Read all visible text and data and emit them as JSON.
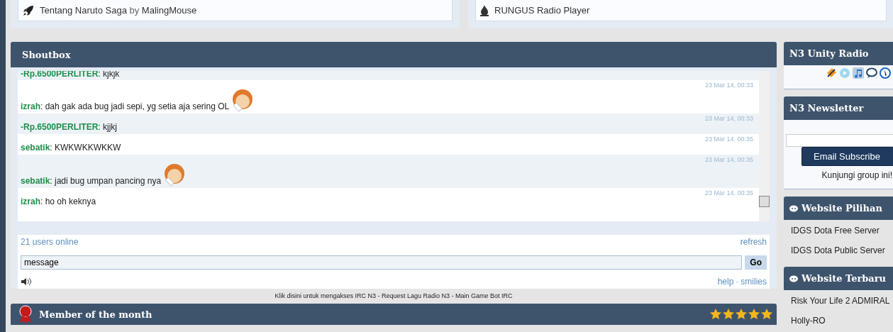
{
  "top_links": [
    {
      "kind": "rocket",
      "title": "Tentang Naruto Saga",
      "by": "by",
      "author": "MalingMouse"
    },
    {
      "kind": "flame",
      "title": "RUNGUS Radio Player"
    }
  ],
  "shoutbox": {
    "title": "Shoutbox",
    "messages": [
      {
        "user": "-Rp.6500PERLITER",
        "text": "kjkjk",
        "emoticon": false
      },
      {
        "time": "23 Mar 14, 00:33",
        "user": "izrah",
        "text": "dah gak ada bug jadi sepi, yg setia aja sering OL",
        "emoticon": true
      },
      {
        "time": "23 Mar 14, 00:33",
        "user": "-Rp.6500PERLITER",
        "text": "kjjkj",
        "emoticon": false
      },
      {
        "time": "23 Mar 14, 00:35",
        "user": "sebatik",
        "text": "KWKWKKWKKW",
        "emoticon": false
      },
      {
        "time": "23 Mar 14, 00:35",
        "user": "sebatik",
        "text": "jadi bug umpan pancing nya",
        "emoticon": true
      },
      {
        "time": "23 Mar 14, 00:35",
        "user": "izrah",
        "text": "ho oh keknya",
        "emoticon": false
      }
    ],
    "name_separator": ":",
    "users_online": "21 users online",
    "refresh": "refresh",
    "message_value": "message",
    "go": "Go",
    "help": "help",
    "separator": "·",
    "smilies": "smilies",
    "caption": "Klik disini untuk mengakses IRC N3 - Request Lagu Radio N3 - Main Game Bot IRC"
  },
  "member_of_month": {
    "title": "Member of the month",
    "stars": 5
  },
  "sidebar": [
    {
      "kind": "radio",
      "title": "N3 Unity Radio"
    },
    {
      "kind": "newsletter",
      "title": "N3 Newsletter",
      "button": "Email Subscribe",
      "note": "Kunjungi group ini!"
    },
    {
      "kind": "links",
      "title": "Website Pilihan",
      "items": [
        "IDGS Dota Free Server",
        "IDGS Dota Public Server"
      ]
    },
    {
      "kind": "links",
      "title": "Website Terbaru",
      "items": [
        "Risk Your Life 2 ADMIRAL",
        "Holly-RO"
      ]
    }
  ]
}
